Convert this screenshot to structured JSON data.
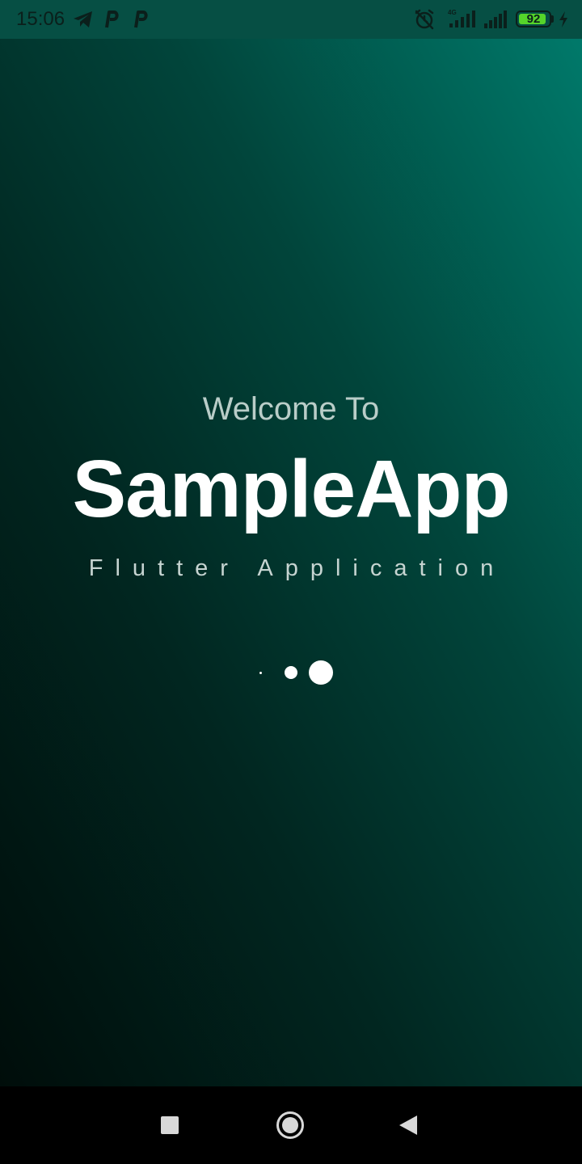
{
  "status_bar": {
    "time": "15:06",
    "left_icons": [
      "telegram-icon",
      "parking-icon",
      "parking-icon"
    ],
    "right_icons": [
      "alarm-off-icon",
      "signal-4g-icon",
      "signal-icon",
      "battery-icon",
      "charging-icon"
    ],
    "battery_level": 92,
    "battery_text": "92",
    "network_label": "4G",
    "battery_color": "#55d42a"
  },
  "splash": {
    "welcome_text": "Welcome To",
    "app_name": "SampleApp",
    "subtitle": "Flutter Application",
    "loader_dots": 3,
    "gradient_colors": [
      "#00796a",
      "#01453b",
      "#012620",
      "#000d0a"
    ]
  },
  "nav_bar": {
    "buttons": [
      "recent-apps",
      "home",
      "back"
    ]
  }
}
